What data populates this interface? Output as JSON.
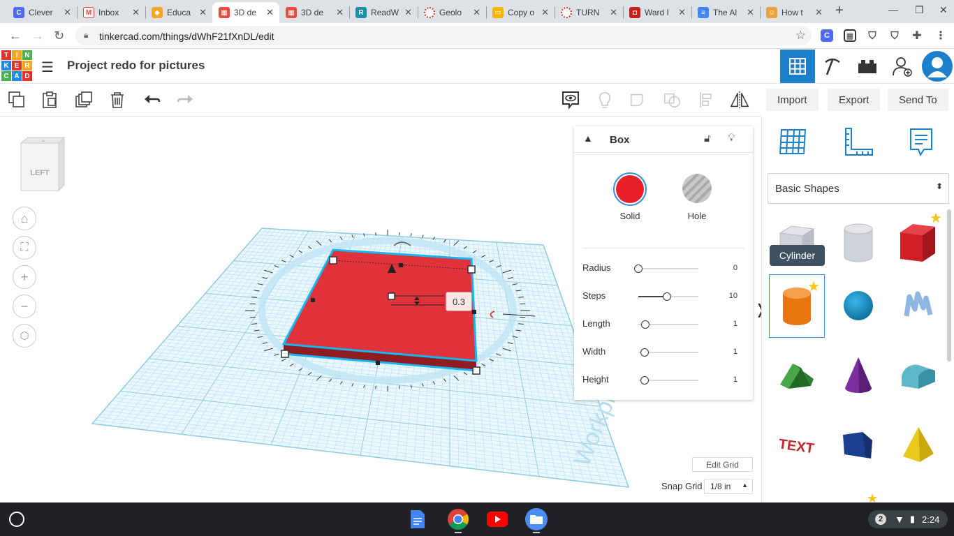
{
  "browser": {
    "tabs": [
      {
        "title": "Clever",
        "favicon": "C",
        "color": "#4f6bf5"
      },
      {
        "title": "Inbox",
        "favicon": "M",
        "color": "#ea4335"
      },
      {
        "title": "Educa",
        "favicon": "◆",
        "color": "#f6a623"
      },
      {
        "title": "3D de",
        "favicon": "▦",
        "color": "#e84c3d",
        "active": true
      },
      {
        "title": "3D de",
        "favicon": "▦",
        "color": "#e84c3d"
      },
      {
        "title": "ReadW",
        "favicon": "R",
        "color": "#1a8fa8"
      },
      {
        "title": "Geolo",
        "favicon": "○",
        "color": "#d93025"
      },
      {
        "title": "Copy o",
        "favicon": "▭",
        "color": "#f4b400"
      },
      {
        "title": "TURN",
        "favicon": "○",
        "color": "#d93025"
      },
      {
        "title": "Ward I",
        "favicon": "◘",
        "color": "#c5221f"
      },
      {
        "title": "The Al",
        "favicon": "≡",
        "color": "#4285f4"
      },
      {
        "title": "How t",
        "favicon": "☺",
        "color": "#e8a33c"
      }
    ],
    "url": "tinkercad.com/things/dWhF21fXnDL/edit"
  },
  "app": {
    "logo_letters": [
      "T",
      "I",
      "N",
      "K",
      "E",
      "R",
      "C",
      "A",
      "D"
    ],
    "project_title": "Project redo for pictures"
  },
  "toolbar": {
    "import_label": "Import",
    "export_label": "Export",
    "sendto_label": "Send To"
  },
  "viewcube": {
    "face_label": "LEFT"
  },
  "workplane": {
    "dimension_value": "0.3",
    "watermark": "Workplane"
  },
  "inspector": {
    "shape_name": "Box",
    "solid_label": "Solid",
    "hole_label": "Hole",
    "solid_color": "#e8202a",
    "properties": [
      {
        "label": "Radius",
        "value": "0",
        "fraction": 0
      },
      {
        "label": "Steps",
        "value": "10",
        "fraction": 0.48
      },
      {
        "label": "Length",
        "value": "1",
        "fraction": 0.12
      },
      {
        "label": "Width",
        "value": "1",
        "fraction": 0.1
      },
      {
        "label": "Height",
        "value": "1",
        "fraction": 0.1
      }
    ]
  },
  "shapes_panel": {
    "category": "Basic Shapes",
    "tooltip": "Cylinder",
    "shapes": [
      "Box (hole)",
      "Cylinder (hole)",
      "Box",
      "Cylinder",
      "Sphere",
      "Scribble",
      "Roof",
      "Cone",
      "Round Roof",
      "Text",
      "Polygon",
      "Pyramid"
    ]
  },
  "bottom": {
    "edit_grid_label": "Edit Grid",
    "snap_grid_label": "Snap Grid",
    "snap_grid_value": "1/8 in"
  },
  "taskbar": {
    "notification_count": "2",
    "time": "2:24"
  }
}
